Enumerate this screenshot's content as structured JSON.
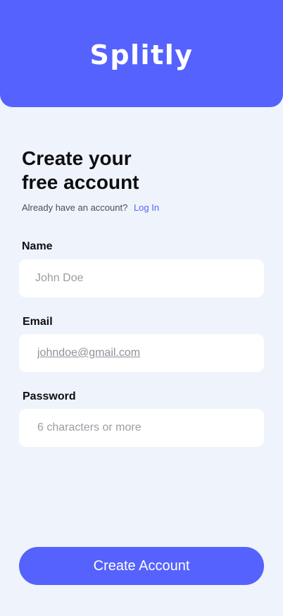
{
  "app": {
    "logo_text": "Splitly"
  },
  "form": {
    "title_line1": "Create your",
    "title_line2": "free account",
    "login_prompt": "Already have an account?",
    "login_link": "Log In",
    "name": {
      "label": "Name",
      "placeholder": "John Doe"
    },
    "email": {
      "label": "Email",
      "value": "johndoe@gmail.com"
    },
    "password": {
      "label": "Password",
      "placeholder": "6 characters or more"
    },
    "submit_label": "Create Account"
  },
  "colors": {
    "accent": "#5562FD",
    "background": "#EFF4FC",
    "field_bg": "#FFFFFF"
  }
}
